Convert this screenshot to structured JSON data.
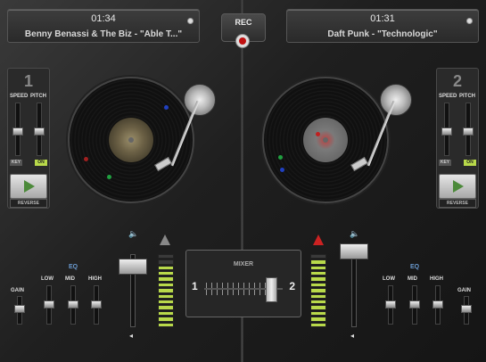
{
  "deck_left": {
    "time": "01:34",
    "track": "Benny Benassi & The Biz - \"Able T...\"",
    "number": "1",
    "speed_label": "SPEED",
    "pitch_label": "PITCH",
    "key_label": "KEY",
    "on_label": "ON",
    "reverse_label": "REVERSE"
  },
  "deck_right": {
    "time": "01:31",
    "track": "Daft Punk - \"Technologic\"",
    "number": "2",
    "speed_label": "SPEED",
    "pitch_label": "PITCH",
    "key_label": "KEY",
    "on_label": "ON",
    "reverse_label": "REVERSE"
  },
  "rec": {
    "label": "REC"
  },
  "mixer": {
    "title": "MIXER",
    "left": "1",
    "right": "2",
    "crossfader_position": 0.85
  },
  "eq_left": {
    "title": "EQ",
    "gain": "GAIN",
    "low": "LOW",
    "mid": "MID",
    "high": "HIGH"
  },
  "eq_right": {
    "title": "EQ",
    "gain": "GAIN",
    "low": "LOW",
    "mid": "MID",
    "high": "HIGH"
  },
  "meters": {
    "left_level": 0.85,
    "right_level": 0.9
  },
  "colors": {
    "meter_on": "#b8d94a",
    "rec_red": "#c01010",
    "eq_title": "#6a9ad0"
  },
  "icons": [
    "speaker-icon",
    "warning-icon",
    "play-icon",
    "record-icon"
  ]
}
